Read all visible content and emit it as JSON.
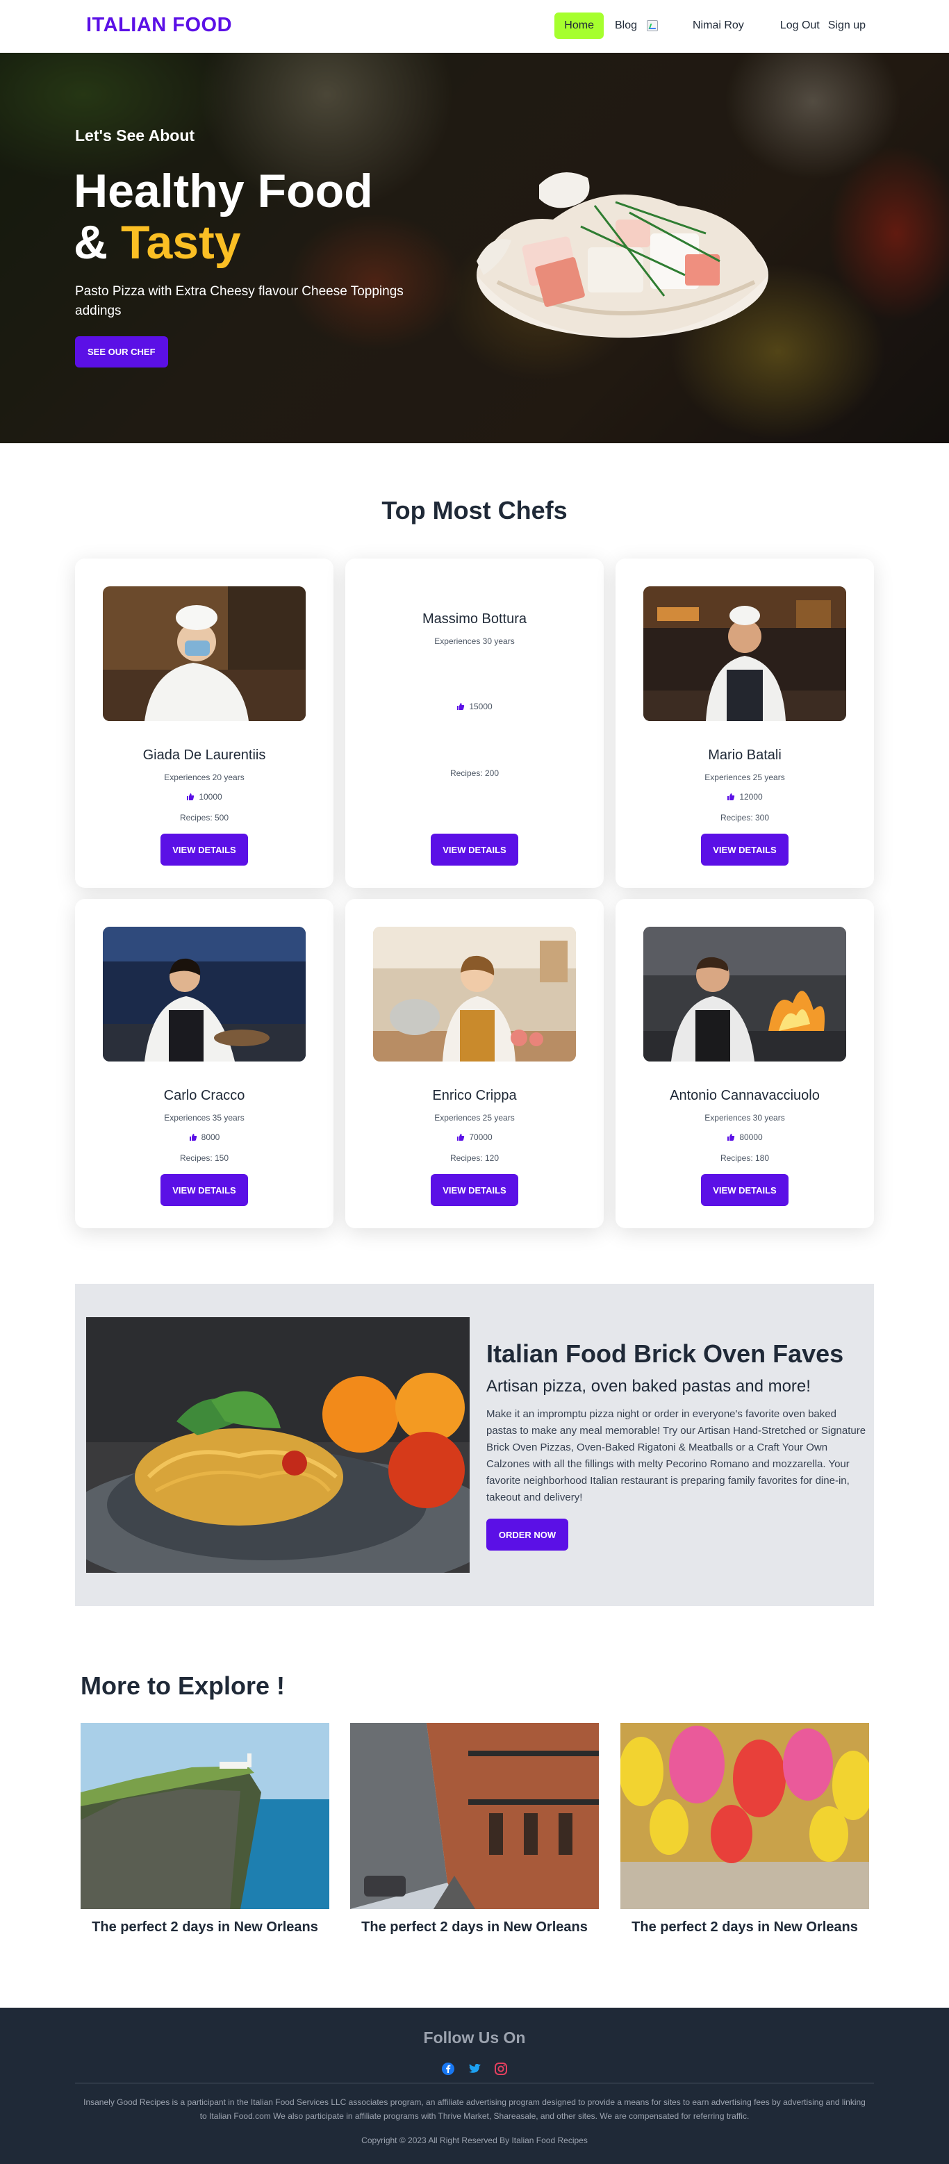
{
  "nav": {
    "brand": "ITALIAN FOOD",
    "home": "Home",
    "blog": "Blog",
    "user": "Nimai Roy",
    "logout": "Log Out",
    "signup": "Sign up"
  },
  "hero": {
    "kicker": "Let's See About",
    "title_line1": "Healthy Food",
    "title_amp": "& ",
    "title_accent": "Tasty",
    "subtitle": "Pasto Pizza with Extra Cheesy flavour Cheese Toppings addings",
    "button": "SEE OUR CHEF"
  },
  "chefs": {
    "title": "Top Most Chefs",
    "button_label": "VIEW DETAILS",
    "items": [
      {
        "name": "Giada De Laurentiis",
        "experience": "Experiences 20 years",
        "likes": "10000",
        "recipes": "Recipes: 500"
      },
      {
        "name": "Massimo Bottura",
        "experience": "Experiences 30 years",
        "likes": "15000",
        "recipes": "Recipes: 200"
      },
      {
        "name": "Mario Batali",
        "experience": "Experiences 25 years",
        "likes": "12000",
        "recipes": "Recipes: 300"
      },
      {
        "name": "Carlo Cracco",
        "experience": "Experiences 35 years",
        "likes": "8000",
        "recipes": "Recipes: 150"
      },
      {
        "name": "Enrico Crippa",
        "experience": "Experiences 25 years",
        "likes": "70000",
        "recipes": "Recipes: 120"
      },
      {
        "name": "Antonio Cannavacciuolo",
        "experience": "Experiences 30 years",
        "likes": "80000",
        "recipes": "Recipes: 180"
      }
    ]
  },
  "oven": {
    "title": "Italian Food Brick Oven Faves",
    "subtitle": "Artisan pizza, oven baked pastas and more!",
    "description": "Make it an impromptu pizza night or order in everyone's favorite oven baked pastas to make any meal memorable! Try our Artisan Hand-Stretched or Signature Brick Oven Pizzas, Oven-Baked Rigatoni & Meatballs or a Craft Your Own Calzones with all the fillings with melty Pecorino Romano and mozzarella. Your favorite neighborhood Italian restaurant is preparing family favorites for dine-in, takeout and delivery!",
    "button": "ORDER NOW"
  },
  "explore": {
    "title": "More to Explore !",
    "items": [
      {
        "caption": "The perfect 2 days in New Orleans"
      },
      {
        "caption": "The perfect 2 days in New Orleans"
      },
      {
        "caption": "The perfect 2 days in New Orleans"
      }
    ]
  },
  "footer": {
    "follow": "Follow Us On",
    "social_icons": [
      "facebook-icon",
      "twitter-icon",
      "instagram-icon"
    ],
    "disclaimer": "Insanely Good Recipes is a participant in the Italian Food Services LLC associates program, an affiliate advertising program designed to provide a means for sites to earn advertising fees by advertising and linking to Italian Food.com We also participate in affiliate programs with Thrive Market, Shareasale, and other sites. We are compensated for referring traffic.",
    "copyright": "Copyright © 2023 All Right Reserved By Italian Food Recipes"
  },
  "colors": {
    "brand": "#5b10e6",
    "home_highlight": "#a6ff2e",
    "accent_yellow": "#fbbf24",
    "footer_bg": "#1f2937"
  }
}
